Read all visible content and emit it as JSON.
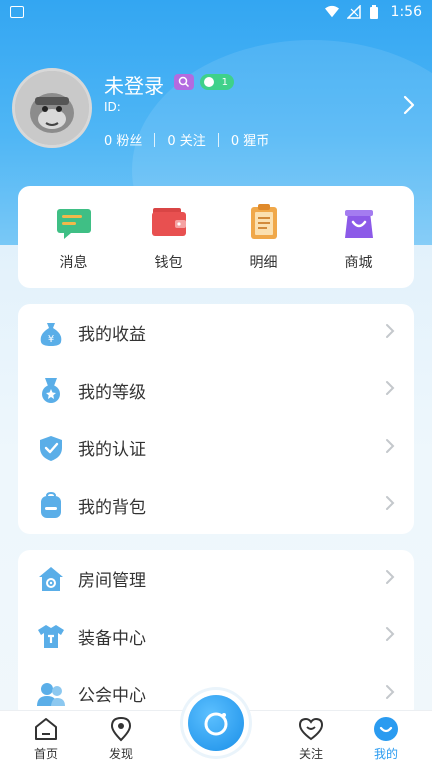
{
  "status_bar": {
    "time": "1:56"
  },
  "profile": {
    "username": "未登录",
    "badge_level": "1",
    "id_label": "ID:",
    "fans": "0 粉丝",
    "following": "0 关注",
    "coins": "0 猩币"
  },
  "quick_actions": [
    {
      "label": "消息",
      "icon": "message-icon"
    },
    {
      "label": "钱包",
      "icon": "wallet-icon"
    },
    {
      "label": "明细",
      "icon": "details-clipboard-icon"
    },
    {
      "label": "商城",
      "icon": "shop-bag-icon"
    }
  ],
  "menu_group_1": [
    {
      "label": "我的收益",
      "icon": "income-moneybag-icon"
    },
    {
      "label": "我的等级",
      "icon": "level-medal-icon"
    },
    {
      "label": "我的认证",
      "icon": "certification-shield-icon"
    },
    {
      "label": "我的背包",
      "icon": "backpack-icon"
    }
  ],
  "menu_group_2": [
    {
      "label": "房间管理",
      "icon": "room-house-icon"
    },
    {
      "label": "装备中心",
      "icon": "equipment-shirt-icon"
    },
    {
      "label": "公会中心",
      "icon": "guild-people-icon"
    }
  ],
  "bottom_nav": {
    "home": "首页",
    "discover": "发现",
    "follow": "关注",
    "mine": "我的"
  },
  "colors": {
    "header_blue": "#33a6f2",
    "accent": "#2a9bf0",
    "icon_blue": "#5aaee8"
  }
}
